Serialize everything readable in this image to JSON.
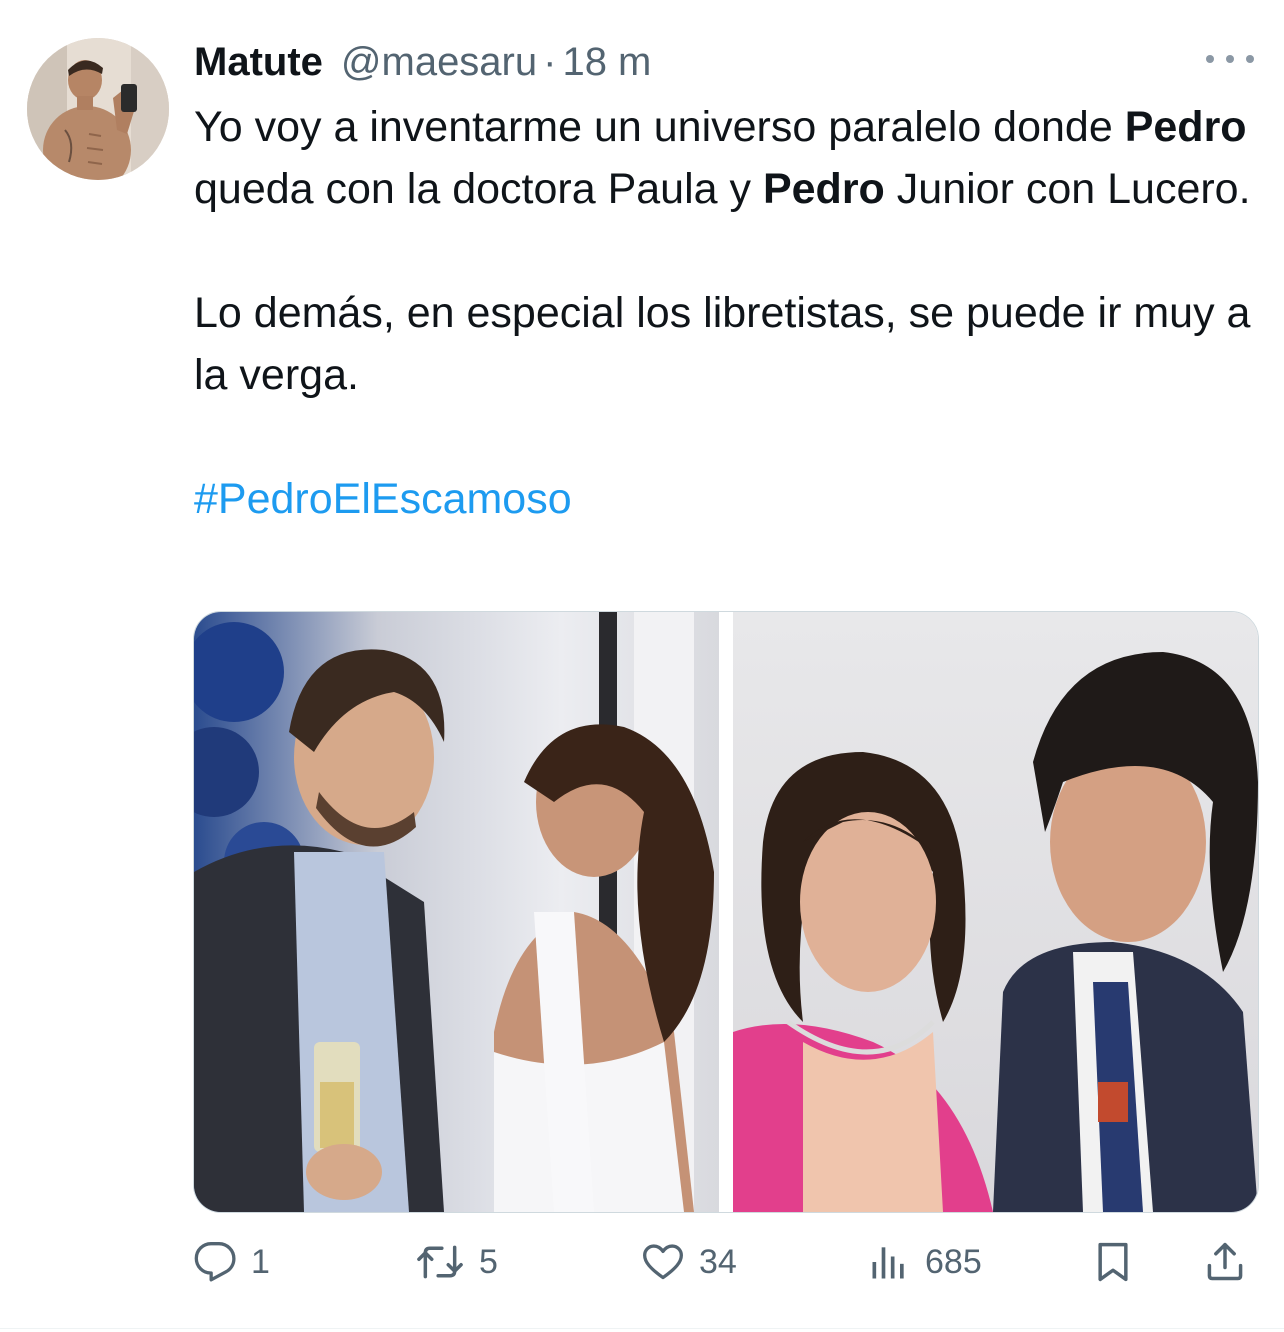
{
  "tweet": {
    "author": {
      "display_name": "Matute",
      "handle": "@maesaru",
      "separator": "·",
      "time": "18 m"
    },
    "body": {
      "line1_a": "Yo voy a inventarme un universo paralelo donde ",
      "bold1": "Pedro",
      "line1_b": " queda con la doctora Paula y ",
      "bold2": "Pedro",
      "line1_c": " Junior con Lucero.",
      "paragraph2": "Lo demás, en especial los libretistas, se puede ir muy a la verga.",
      "hashtag": "#PedroElEscamoso"
    },
    "actions": {
      "replies": "1",
      "retweets": "5",
      "likes": "34",
      "views": "685"
    }
  },
  "icons": {
    "more": "more-horizontal-icon",
    "reply": "reply-bubble-icon",
    "retweet": "retweet-icon",
    "like": "heart-icon",
    "views": "bar-chart-icon",
    "bookmark": "bookmark-icon",
    "share": "share-icon"
  },
  "colors": {
    "text": "#0f1419",
    "secondary": "#536471",
    "link": "#1d9bf0",
    "border": "#cfd9de"
  }
}
